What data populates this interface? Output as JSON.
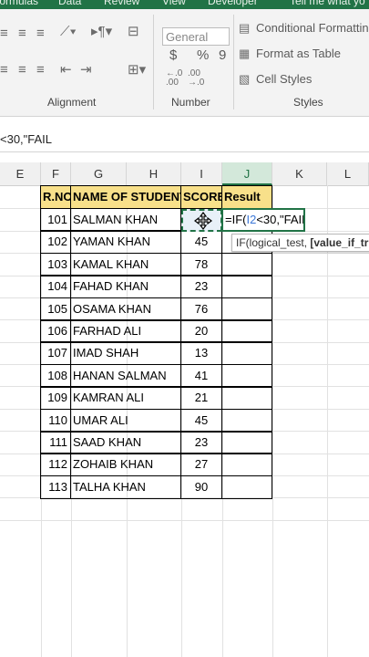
{
  "ribbon_tabs": [
    "Formulas",
    "Data",
    "Review",
    "View",
    "Developer",
    "Tell me what yo"
  ],
  "ribbon": {
    "number_format": "General",
    "conditional_formatting": "Conditional Formatting",
    "format_as_table": "Format as Table",
    "cell_styles": "Cell Styles",
    "currency": "$",
    "percent": "%",
    "comma": "9",
    "groups": {
      "alignment": "Alignment",
      "number": "Number",
      "styles": "Styles"
    }
  },
  "formula_bar": {
    "text": "<30,\"FAIL"
  },
  "columns": [
    "E",
    "F",
    "G",
    "H",
    "I",
    "J",
    "K",
    "L"
  ],
  "selected_column": "J",
  "table": {
    "headers": {
      "rno": "R.NO",
      "name": "NAME OF STUDENTS",
      "score": "SCORE",
      "result": "Result"
    },
    "rows": [
      {
        "rno": "101",
        "name": "SALMAN KHAN",
        "score": ""
      },
      {
        "rno": "102",
        "name": "YAMAN KHAN",
        "score": "45"
      },
      {
        "rno": "103",
        "name": "KAMAL KHAN",
        "score": "78"
      },
      {
        "rno": "104",
        "name": "FAHAD KHAN",
        "score": "23"
      },
      {
        "rno": "105",
        "name": "OSAMA KHAN",
        "score": "76"
      },
      {
        "rno": "106",
        "name": "FARHAD ALI",
        "score": "20"
      },
      {
        "rno": "107",
        "name": "IMAD SHAH",
        "score": "13"
      },
      {
        "rno": "108",
        "name": "HANAN SALMAN",
        "score": "41"
      },
      {
        "rno": "109",
        "name": "KAMRAN ALI",
        "score": "21"
      },
      {
        "rno": "110",
        "name": "UMAR ALI",
        "score": "45"
      },
      {
        "rno": "111",
        "name": "SAAD KHAN",
        "score": "23"
      },
      {
        "rno": "112",
        "name": "ZOHAIB KHAN",
        "score": "27"
      },
      {
        "rno": "113",
        "name": "TALHA KHAN",
        "score": "90"
      }
    ]
  },
  "editing_cell": {
    "prefix": "=IF(",
    "ref": "I2",
    "suffix": "<30,\"FAIL"
  },
  "tooltip": {
    "normal": "IF(logical_test, ",
    "bold": "[value_if_true]"
  },
  "colors": {
    "accent": "#217346",
    "header_fill": "#f8e08a",
    "cell_ref": "#3c78d8"
  },
  "icons": [
    "align-left-icon",
    "align-center-icon",
    "align-right-icon",
    "orientation-icon",
    "wrap-text-icon",
    "merge-cells-icon",
    "decrease-indent-icon",
    "increase-indent-icon",
    "increase-decimal-icon",
    "decrease-decimal-icon",
    "conditional-formatting-icon",
    "format-as-table-icon",
    "cell-styles-icon",
    "move-cursor-icon"
  ]
}
